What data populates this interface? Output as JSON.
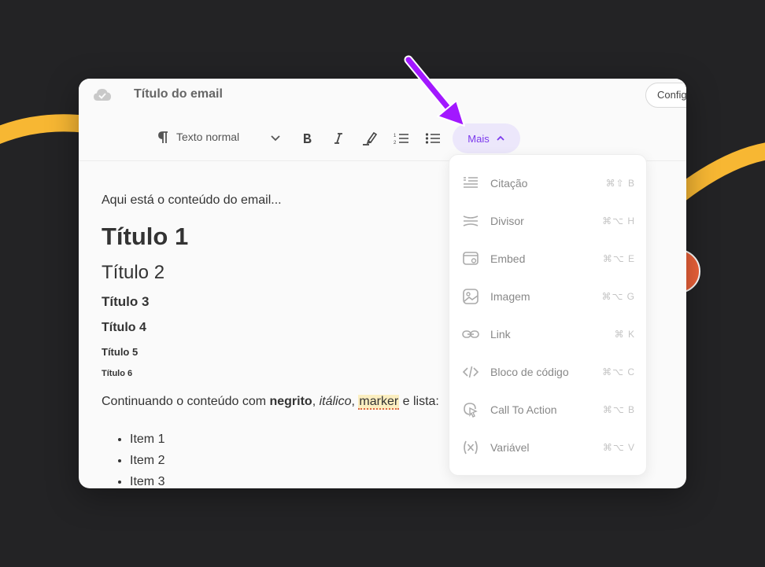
{
  "header": {
    "title": "Título do email",
    "config_label": "Config"
  },
  "toolbar": {
    "style_select": "Texto normal",
    "more_label": "Mais",
    "icons": [
      "paragraph-icon",
      "bold-icon",
      "italic-icon",
      "highlighter-icon",
      "ordered-list-icon",
      "bullet-list-icon"
    ]
  },
  "content": {
    "intro": "Aqui está o conteúdo do email...",
    "h1": "Título 1",
    "h2": "Título 2",
    "h3": "Título 3",
    "h4": "Título 4",
    "h5": "Título 5",
    "h6": "Título 6",
    "rich": {
      "prefix": "Continuando o conteúdo com ",
      "bold": "negrito",
      "sep1": ", ",
      "italic": "itálico",
      "sep2": ", ",
      "marker": "marker",
      "suffix": " e lista:"
    },
    "list": [
      "Item 1",
      "Item 2",
      "Item 3"
    ]
  },
  "dropdown": {
    "items": [
      {
        "label": "Citação",
        "shortcut": "⌘⇧ B",
        "icon": "quote-icon"
      },
      {
        "label": "Divisor",
        "shortcut": "⌘⌥ H",
        "icon": "divider-icon"
      },
      {
        "label": "Embed",
        "shortcut": "⌘⌥ E",
        "icon": "embed-icon"
      },
      {
        "label": "Imagem",
        "shortcut": "⌘⌥ G",
        "icon": "image-icon"
      },
      {
        "label": "Link",
        "shortcut": "⌘ K",
        "icon": "link-icon"
      },
      {
        "label": "Bloco de código",
        "shortcut": "⌘⌥ C",
        "icon": "code-icon"
      },
      {
        "label": "Call To Action",
        "shortcut": "⌘⌥ B",
        "icon": "cursor-click-icon"
      },
      {
        "label": "Variável",
        "shortcut": "⌘⌥ V",
        "icon": "variable-icon"
      }
    ]
  },
  "colors": {
    "background": "#232325",
    "accent": "#7c3aed",
    "accent_bg": "#ece7fb",
    "decor_yellow": "#f7b733",
    "decor_orange": "#f0633a",
    "arrow": "#a218ff"
  }
}
